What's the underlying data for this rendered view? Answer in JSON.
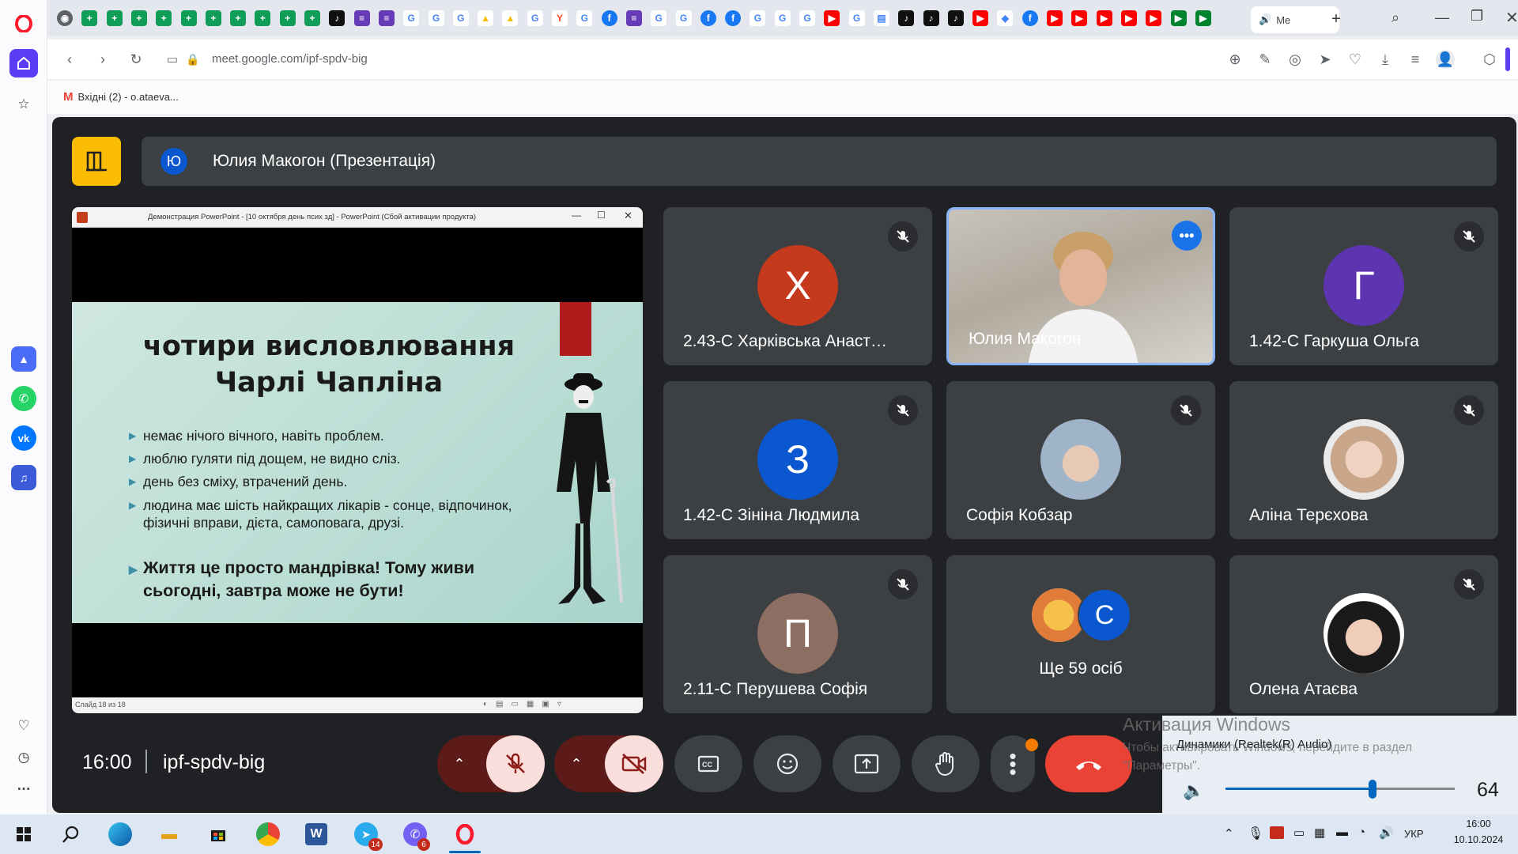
{
  "browser": {
    "url_host": "meet.google.com/",
    "url_path": "ipf-spdv-big",
    "active_tab_title": "Me",
    "bookmark_label": "Вхідні (2) - o.ataeva..."
  },
  "meet": {
    "presenter_initial": "Ю",
    "presenter_banner": "Юлия Макогон (Презентація)",
    "time": "16:00",
    "meeting_code": "ipf-spdv-big",
    "more_people_initial": "С",
    "more_people_label": "Ще 59 осіб"
  },
  "slide": {
    "window_title": "Демонстрация PowerPoint - [10 октября день псих зд] - PowerPoint (Сбой активации продукта)",
    "title_line1": "чотири висловлювання",
    "title_line2": "Чарлі Чапліна",
    "bullets": [
      "немає нічого вічного, навіть проблем.",
      "люблю гуляти під дощем, не видно сліз.",
      "день без сміху, втрачений день.",
      "людина має шість найкращих лікарів - сонце, відпочинок, фізичні вправи, дієта, самоповага, друзі."
    ],
    "bold_quote": "Життя це просто мандрівка! Тому живи сьогодні, завтра може не бути!",
    "status_left": "Слайд 18 из 18"
  },
  "participants": [
    {
      "initial": "Х",
      "name": "2.43-С Харківська Анаст…",
      "color": "#c5391c"
    },
    {
      "initial": "",
      "name": "Юлия Макогон",
      "color": "#a89f92"
    },
    {
      "initial": "Г",
      "name": "1.42-С Гаркуша Ольга",
      "color": "#5e35b1"
    },
    {
      "initial": "З",
      "name": "1.42-С Зініна Людмила",
      "color": "#0b57d0"
    },
    {
      "initial": "",
      "name": "Софія Кобзар",
      "color": "#9fb4c8"
    },
    {
      "initial": "",
      "name": "Аліна Терєхова",
      "color": "#d9b9a6"
    },
    {
      "initial": "П",
      "name": "2.11-С Перушева Софія",
      "color": "#8d6e63"
    },
    {
      "initial": "",
      "name": "Олена Атаєва",
      "color": "#e8e0dc"
    }
  ],
  "volume": {
    "watermark_line1": "Активация Windows",
    "watermark_line2": "Чтобы активировать Windows, перейдите в раздел",
    "watermark_line3": "\"Параметры\".",
    "device": "Динамики (Realtek(R) Audio)",
    "value": "64",
    "level": 0.64
  },
  "taskbar": {
    "lang": "УКР",
    "clock_time": "16:00",
    "clock_date": "10.10.2024",
    "telegram_badge": "14",
    "viber_badge": "6"
  },
  "colors": {
    "meet_bg": "#202124",
    "tile_bg": "#3c4043",
    "end_call": "#ea4335",
    "accent_blue": "#8ab4f8",
    "opera_red": "#ff1b2d"
  }
}
